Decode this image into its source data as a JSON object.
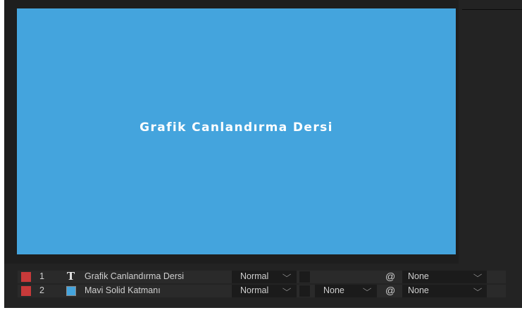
{
  "composition": {
    "text": "Grafik Canlandırma Dersi",
    "background_color": "#44a4dd"
  },
  "layers": [
    {
      "index": "1",
      "label_color": "#c83a3a",
      "type_icon": "text-layer-icon",
      "type_glyph": "T",
      "name": "Grafik Canlandırma Dersi",
      "mode": "Normal",
      "track_matte": "",
      "parent_link_icon": "pickwhip-spiral-icon",
      "parent_glyph": "@",
      "parent": "None"
    },
    {
      "index": "2",
      "label_color": "#c83a3a",
      "type_icon": "solid-layer-icon",
      "solid_color": "#44a4dd",
      "name": "Mavi Solid Katmanı",
      "mode": "Normal",
      "track_matte": "None",
      "parent_link_icon": "pickwhip-spiral-icon",
      "parent_glyph": "@",
      "parent": "None"
    }
  ],
  "icons": {
    "dropdown": "chevron-down-icon",
    "dropdown_glyph": "⌵"
  }
}
